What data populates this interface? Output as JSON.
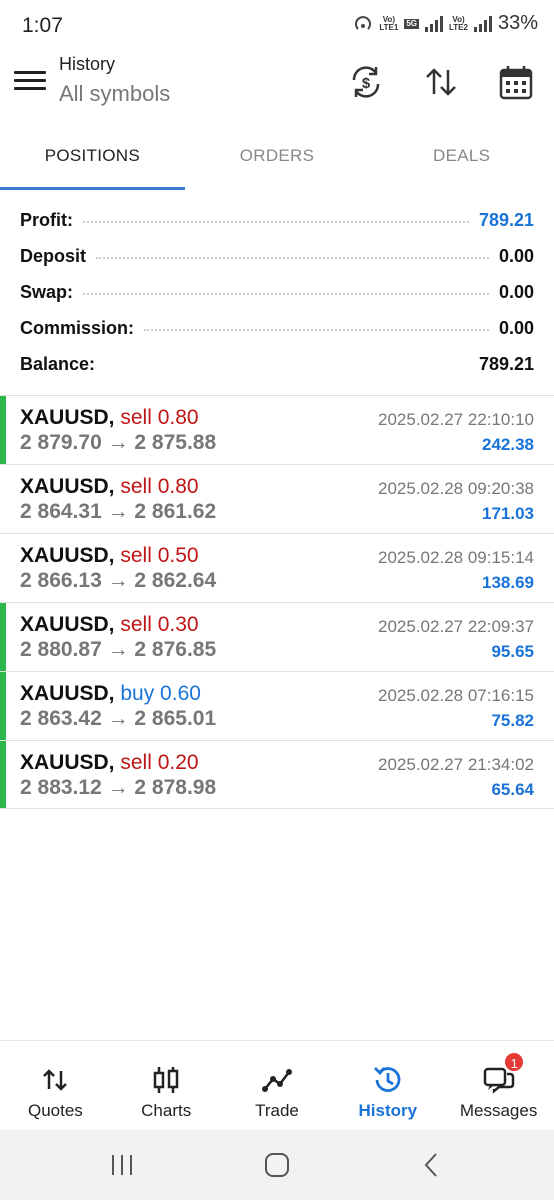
{
  "status_bar": {
    "time": "1:07",
    "battery": "33%",
    "net1_top": "Vo)",
    "net1_bottom": "LTE1",
    "net_5g": "5G",
    "net2_top": "Vo)",
    "net2_bottom": "LTE2"
  },
  "header": {
    "title": "History",
    "subtitle": "All symbols",
    "icons": [
      "menu-icon",
      "currency-sync-icon",
      "sort-icon",
      "calendar-icon"
    ]
  },
  "tabs": [
    {
      "label": "POSITIONS",
      "active": true
    },
    {
      "label": "ORDERS",
      "active": false
    },
    {
      "label": "DEALS",
      "active": false
    }
  ],
  "summary": {
    "profit_label": "Profit:",
    "profit_value": "789.21",
    "deposit_label": "Deposit",
    "deposit_value": "0.00",
    "swap_label": "Swap:",
    "swap_value": "0.00",
    "commission_label": "Commission:",
    "commission_value": "0.00",
    "balance_label": "Balance:",
    "balance_value": "789.21"
  },
  "positions": [
    {
      "symbol": "XAUUSD,",
      "side": "sell 0.80",
      "prices": "2 879.70 → 2 875.88",
      "time": "2025.02.27 22:10:10",
      "profit": "242.38"
    },
    {
      "symbol": "XAUUSD,",
      "side": "sell 0.80",
      "prices": "2 864.31 → 2 861.62",
      "time": "2025.02.28 09:20:38",
      "profit": "171.03"
    },
    {
      "symbol": "XAUUSD,",
      "side": "sell 0.50",
      "prices": "2 866.13 → 2 862.64",
      "time": "2025.02.28 09:15:14",
      "profit": "138.69"
    },
    {
      "symbol": "XAUUSD,",
      "side": "sell 0.30",
      "prices": "2 880.87 → 2 876.85",
      "time": "2025.02.27 22:09:37",
      "profit": "95.65"
    },
    {
      "symbol": "XAUUSD,",
      "side": "buy 0.60",
      "prices": "2 863.42 → 2 865.01",
      "time": "2025.02.28 07:16:15",
      "profit": "75.82"
    },
    {
      "symbol": "XAUUSD,",
      "side": "sell 0.20",
      "prices": "2 883.12 → 2 878.98",
      "time": "2025.02.27 21:34:02",
      "profit": "65.64"
    }
  ],
  "bottom_nav": [
    {
      "label": "Quotes",
      "icon": "quotes-icon"
    },
    {
      "label": "Charts",
      "icon": "charts-icon"
    },
    {
      "label": "Trade",
      "icon": "trade-icon"
    },
    {
      "label": "History",
      "icon": "history-icon",
      "active": true
    },
    {
      "label": "Messages",
      "icon": "messages-icon",
      "badge": "1"
    }
  ],
  "colors": {
    "accent": "#1a73d9",
    "sell": "#c01515",
    "buy": "#1a73d9",
    "position_marker": "#2db84d"
  }
}
